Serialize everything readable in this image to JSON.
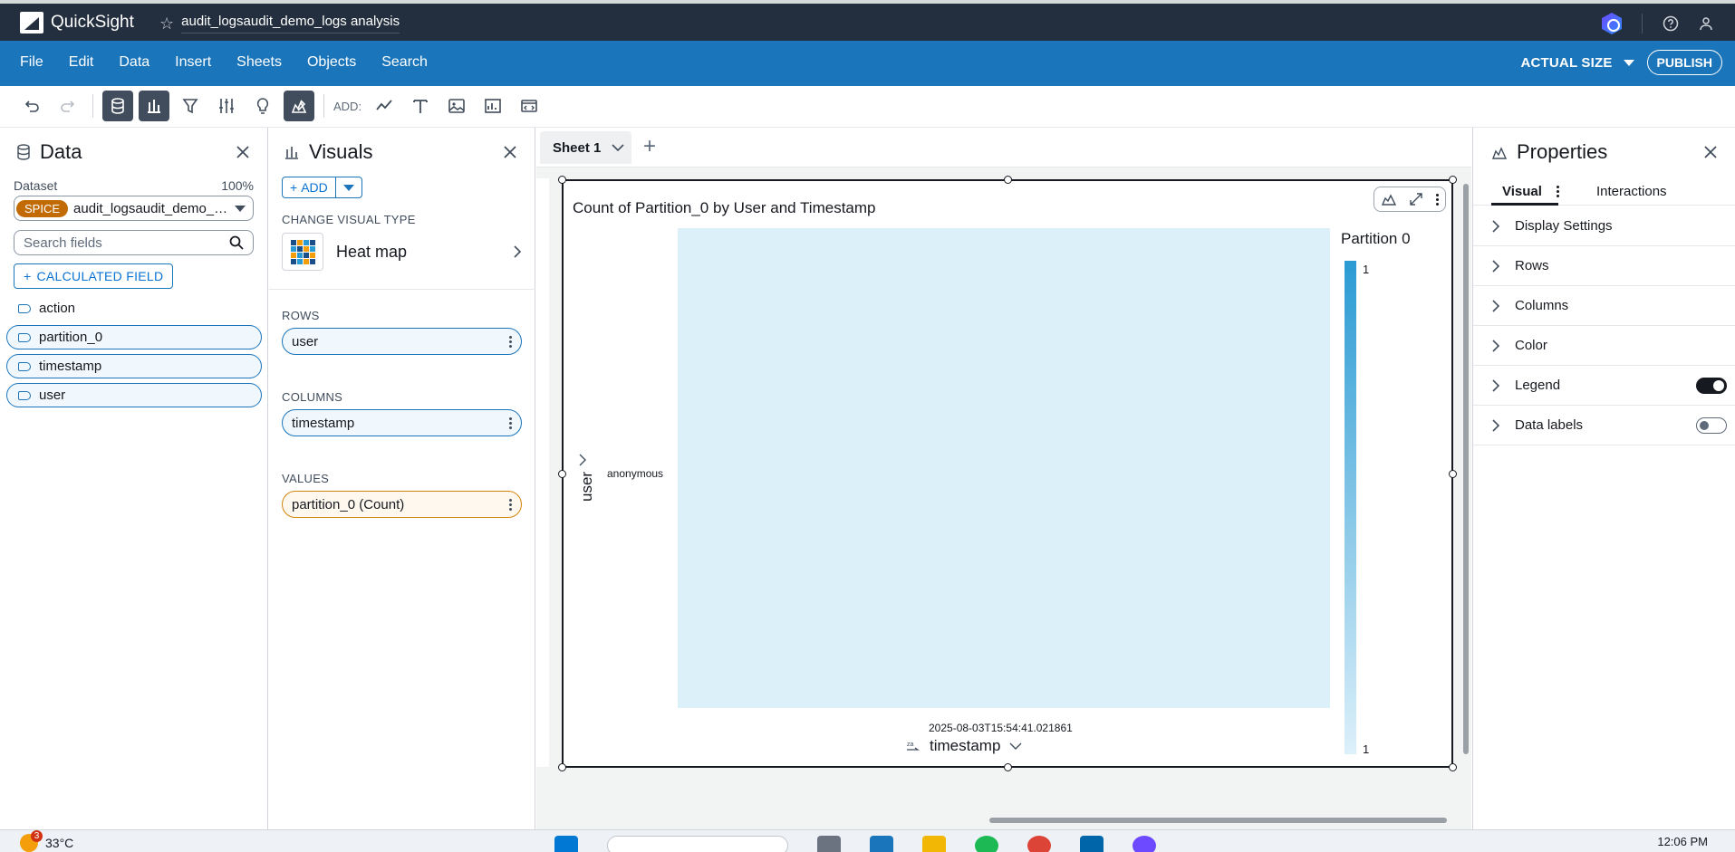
{
  "app": {
    "name": "QuickSight",
    "analysis_title": "audit_logsaudit_demo_logs analysis"
  },
  "menubar": {
    "menus": [
      "File",
      "Edit",
      "Data",
      "Insert",
      "Sheets",
      "Objects",
      "Search"
    ],
    "actual_size": "ACTUAL SIZE",
    "publish": "PUBLISH"
  },
  "toolbar": {
    "add_label": "ADD:"
  },
  "data_panel": {
    "title": "Data",
    "dataset_label": "Dataset",
    "dataset_pct": "100%",
    "spice_badge": "SPICE",
    "dataset_name": "audit_logsaudit_demo_logs",
    "search_placeholder": "Search fields",
    "calc_field": "CALCULATED FIELD",
    "fields": [
      {
        "name": "action",
        "in_use": false
      },
      {
        "name": "partition_0",
        "in_use": true
      },
      {
        "name": "timestamp",
        "in_use": true
      },
      {
        "name": "user",
        "in_use": true
      }
    ]
  },
  "visuals_panel": {
    "title": "Visuals",
    "add_label": "ADD",
    "change_type_label": "CHANGE VISUAL TYPE",
    "visual_type": "Heat map",
    "rows_label": "ROWS",
    "rows_field": "user",
    "columns_label": "COLUMNS",
    "columns_field": "timestamp",
    "values_label": "VALUES",
    "values_field": "partition_0 (Count)"
  },
  "sheet": {
    "tab_name": "Sheet 1"
  },
  "visual": {
    "title": "Count of Partition_0 by User and Timestamp",
    "y_axis_label": "user",
    "x_axis_label": "timestamp",
    "legend_title": "Partition 0",
    "legend_max": "1",
    "legend_min": "1"
  },
  "chart_data": {
    "type": "heatmap",
    "title": "Count of Partition_0 by User and Timestamp",
    "xlabel": "timestamp",
    "ylabel": "user",
    "x_categories": [
      "2025-08-03T15:54:41.021861"
    ],
    "y_categories": [
      "anonymous"
    ],
    "values": [
      [
        1
      ]
    ],
    "legend": {
      "title": "Partition 0",
      "min": 1,
      "max": 1,
      "placement": "right"
    },
    "colors": {
      "low": "#dcf0fa",
      "high": "#2b9bd3"
    }
  },
  "properties_panel": {
    "title": "Properties",
    "tabs": [
      "Visual",
      "Interactions"
    ],
    "rows": [
      {
        "label": "Display Settings"
      },
      {
        "label": "Rows"
      },
      {
        "label": "Columns"
      },
      {
        "label": "Color"
      },
      {
        "label": "Legend",
        "toggle": "on"
      },
      {
        "label": "Data labels",
        "toggle": "off"
      }
    ]
  },
  "taskbar": {
    "temperature": "33°C",
    "notifications": "3",
    "time": "12:06 PM"
  }
}
